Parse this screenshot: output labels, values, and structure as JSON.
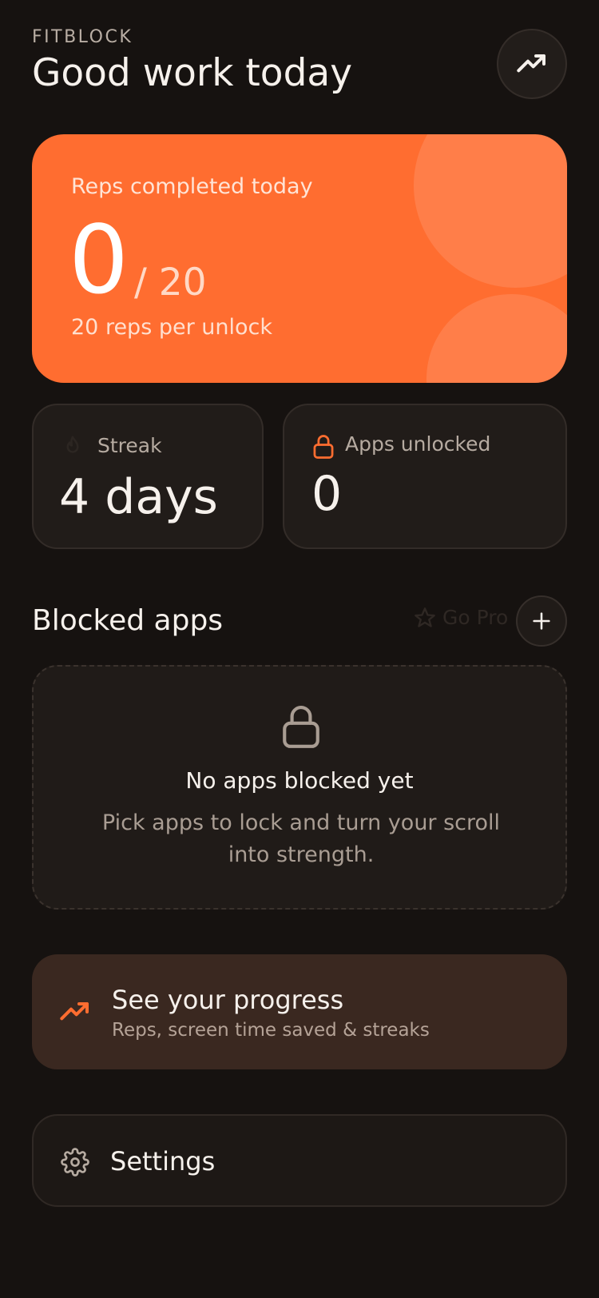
{
  "header": {
    "brand": "FITBLOCK",
    "title": "Good work today",
    "trend_icon": "trending-up-icon"
  },
  "hero": {
    "label": "Reps completed today",
    "count": "0",
    "target": "/ 20",
    "subtitle": "20 reps per unlock",
    "color": "#ff6d30"
  },
  "stats": {
    "streak": {
      "icon": "flame-icon",
      "label": "Streak",
      "value": "4 days"
    },
    "apps": {
      "icon": "lock-icon",
      "label": "Apps unlocked",
      "value": "0"
    }
  },
  "blocked": {
    "title": "Blocked apps",
    "go_pro": "Go Pro",
    "empty_title": "No apps blocked yet",
    "empty_desc": "Pick apps to lock and turn your scroll into strength."
  },
  "progress": {
    "title": "See your progress",
    "subtitle": "Reps, screen time saved & streaks"
  },
  "settings": {
    "label": "Settings"
  },
  "colors": {
    "accent": "#ff6d30",
    "background": "#161210"
  }
}
